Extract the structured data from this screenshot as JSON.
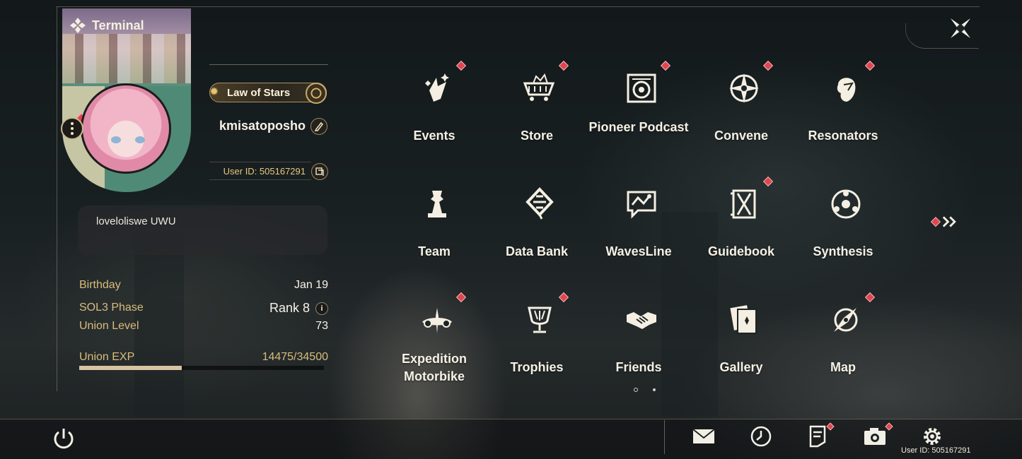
{
  "header": {
    "title": "Terminal"
  },
  "profile": {
    "title_badge": "Law of Stars",
    "username": "kmisatoposho",
    "user_id": "User ID: 505167291",
    "signature": "loveloliswe UWU"
  },
  "stats": {
    "birthday_label": "Birthday",
    "birthday_value": "Jan 19",
    "sol3_label": "SOL3 Phase",
    "sol3_value": "Rank 8",
    "union_level_label": "Union Level",
    "union_level_value": "73",
    "union_exp_label": "Union EXP",
    "union_exp_value": "14475/34500",
    "union_exp_fraction": 0.42
  },
  "menu": {
    "events": "Events",
    "store": "Store",
    "pioneer_podcast": "Pioneer Podcast",
    "convene": "Convene",
    "resonators": "Resonators",
    "team": "Team",
    "data_bank": "Data Bank",
    "wavesline": "WavesLine",
    "guidebook": "Guidebook",
    "synthesis": "Synthesis",
    "expedition_motorbike": "Expedition Motorbike",
    "trophies": "Trophies",
    "friends": "Friends",
    "gallery": "Gallery",
    "map": "Map"
  },
  "pagination": {
    "current": 1,
    "total": 2
  },
  "footer": {
    "user_id": "User ID: 505167291"
  },
  "colors": {
    "accent_gold": "#d8bd7d",
    "notification_red": "#e04550",
    "text_light": "#f5f1e5"
  }
}
